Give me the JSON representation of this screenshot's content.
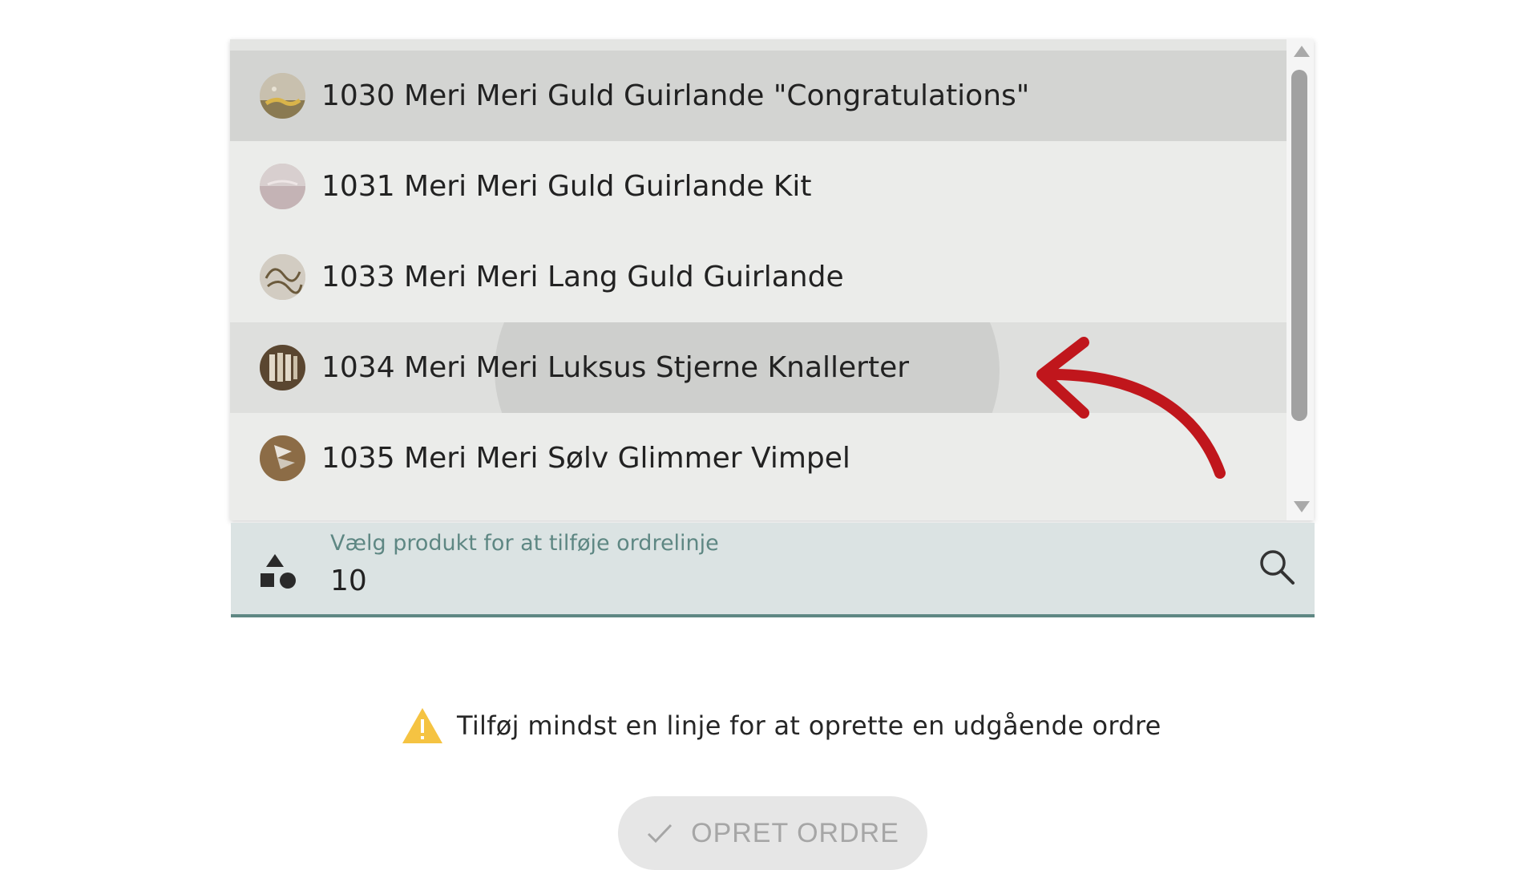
{
  "dropdown": {
    "items": [
      {
        "label": "1030 Meri Meri Guld Guirlande \"Congratulations\"",
        "state": "selected"
      },
      {
        "label": "1031 Meri Meri Guld Guirlande Kit",
        "state": "normal"
      },
      {
        "label": "1033 Meri Meri Lang Guld Guirlande",
        "state": "normal"
      },
      {
        "label": "1034 Meri Meri Luksus Stjerne Knallerter",
        "state": "hovered"
      },
      {
        "label": "1035 Meri Meri Sølv Glimmer Vimpel",
        "state": "normal"
      }
    ]
  },
  "product_field": {
    "label": "Vælg produkt for at tilføje ordrelinje",
    "value": "10",
    "leading_icon": "shapes-icon",
    "trailing_icon": "search-icon"
  },
  "warning": {
    "text": "Tilføj mindst en linje for at oprette en udgående ordre",
    "icon": "warning-icon"
  },
  "create_button": {
    "label": "OPRET ORDRE",
    "icon": "check-icon",
    "enabled": false
  },
  "annotation": {
    "icon": "curved-arrow-icon",
    "color": "#c0161c"
  },
  "colors": {
    "accent": "#5e8783",
    "field_bg": "#dbe3e3",
    "list_bg": "#ebecea",
    "selected_bg": "#d3d4d2",
    "warning": "#f5c342"
  }
}
